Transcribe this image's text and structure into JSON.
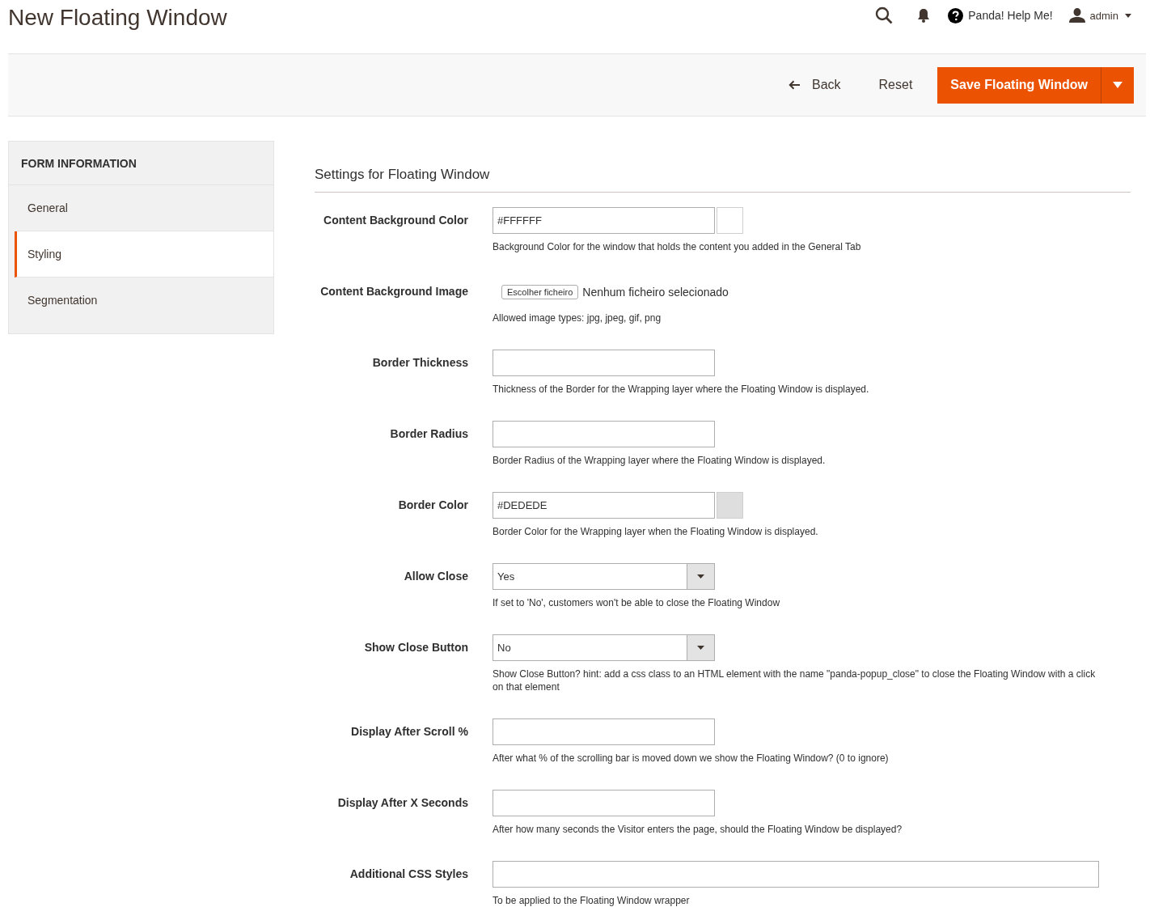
{
  "page_title": "New Floating Window",
  "header": {
    "help_label": "Panda! Help Me!",
    "user": "admin"
  },
  "actions": {
    "back": "Back",
    "reset": "Reset",
    "save": "Save Floating Window"
  },
  "sidebar": {
    "title": "FORM INFORMATION",
    "items": [
      {
        "label": "General",
        "selected": false
      },
      {
        "label": "Styling",
        "selected": true
      },
      {
        "label": "Segmentation",
        "selected": false
      }
    ]
  },
  "section_title": "Settings for Floating Window",
  "fields": [
    {
      "kind": "color",
      "label": "Content Background Color",
      "value": "#FFFFFF",
      "color": "#ffffff",
      "help": "Background Color for the window that holds the content you added in the General Tab"
    },
    {
      "kind": "file",
      "label": "Content Background Image",
      "button": "Escolher ficheiro",
      "status": "Nenhum ficheiro selecionado",
      "help": "Allowed image types: jpg, jpeg, gif, png"
    },
    {
      "kind": "text",
      "label": "Border Thickness",
      "help": "Thickness of the Border for the Wrapping layer where the Floating Window is displayed."
    },
    {
      "kind": "text",
      "label": "Border Radius",
      "help": "Border Radius of the Wrapping layer where the Floating Window is displayed."
    },
    {
      "kind": "color",
      "label": "Border Color",
      "value": "#DEDEDE",
      "color": "#dedede",
      "help": "Border Color for the Wrapping layer when the Floating Window is displayed."
    },
    {
      "kind": "select",
      "label": "Allow Close",
      "value": "Yes",
      "help": "If set to 'No', customers won't be able to close the Floating Window"
    },
    {
      "kind": "select",
      "label": "Show Close Button",
      "value": "No",
      "help": "Show Close Button? hint: add a css class to an HTML element with the name \"panda-popup_close\" to close the Floating Window with a click on that element"
    },
    {
      "kind": "text",
      "label": "Display After Scroll %",
      "help": "After what % of the scrolling bar is moved down we show the Floating Window? (0 to ignore)"
    },
    {
      "kind": "text",
      "label": "Display After X Seconds",
      "help": "After how many seconds the Visitor enters the page, should the Floating Window be displayed?"
    },
    {
      "kind": "wide",
      "label": "Additional CSS Styles",
      "help": "To be applied to the Floating Window wrapper"
    }
  ]
}
